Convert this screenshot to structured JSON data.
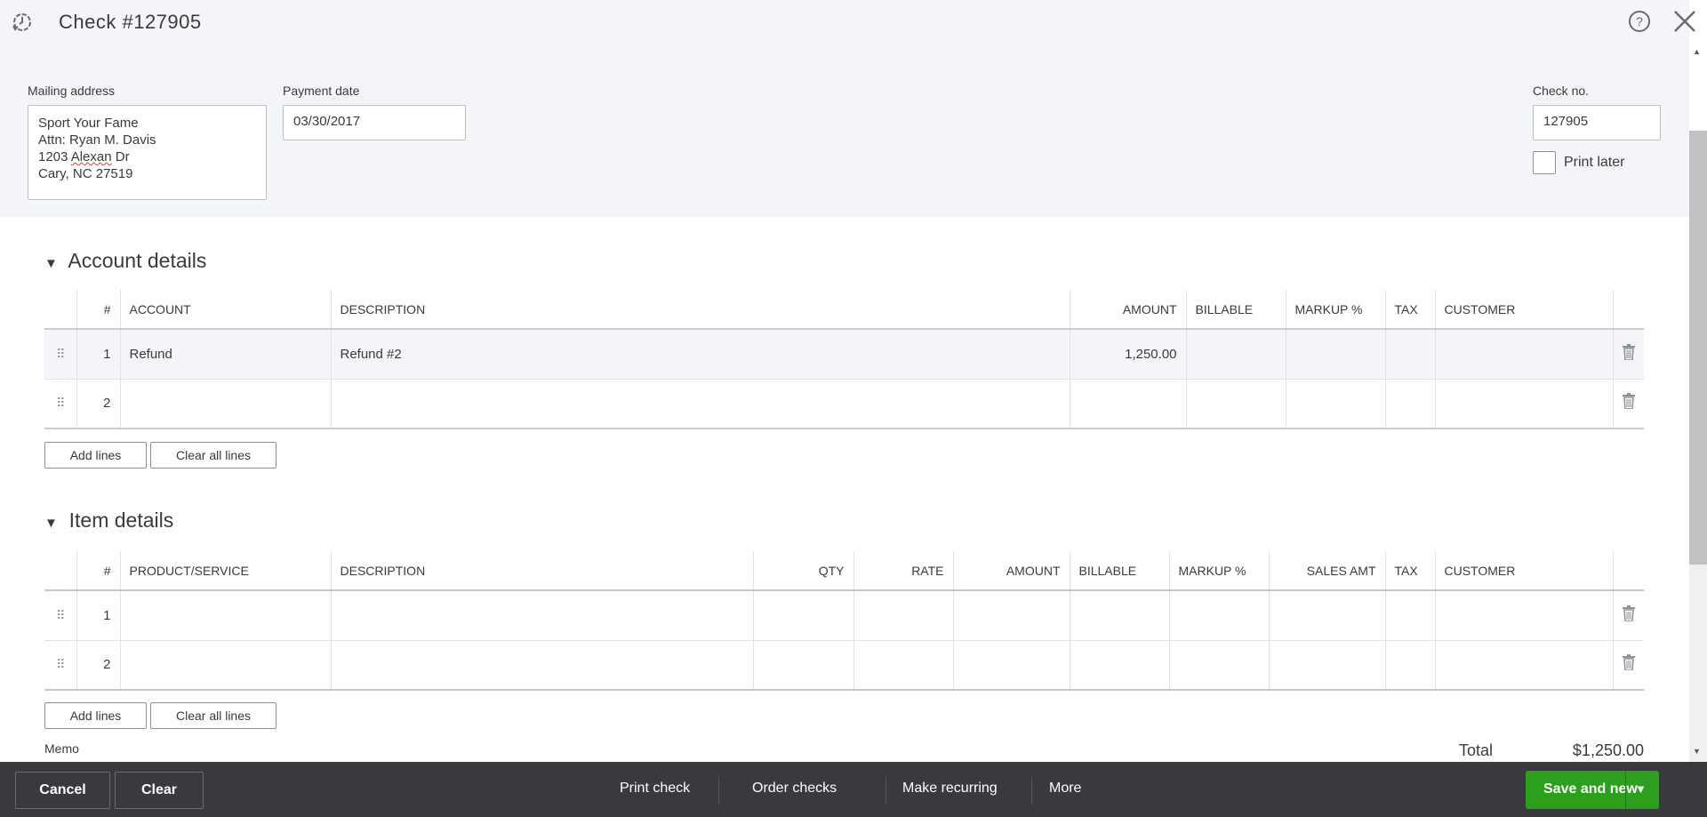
{
  "header": {
    "title": "Check #127905",
    "help_icon": "help-icon",
    "close_icon": "close-icon",
    "history_icon": "history-icon"
  },
  "form": {
    "mailing_label": "Mailing address",
    "address_lines": [
      "Sport Your Fame",
      "Attn: Ryan M. Davis",
      "1203",
      "Alexan",
      "Dr",
      "Cary, NC 27519"
    ],
    "payment_date_label": "Payment date",
    "payment_date": "03/30/2017",
    "check_no_label": "Check no.",
    "check_no": "127905",
    "print_later_label": "Print later",
    "print_later": false
  },
  "account": {
    "title": "Account details",
    "headers": [
      "#",
      "ACCOUNT",
      "DESCRIPTION",
      "AMOUNT",
      "BILLABLE",
      "MARKUP %",
      "TAX",
      "CUSTOMER"
    ],
    "rows": [
      {
        "n": "1",
        "account": "Refund",
        "description": "Refund #2",
        "amount": "1,250.00"
      },
      {
        "n": "2",
        "account": "",
        "description": "",
        "amount": ""
      }
    ],
    "add_lines": "Add lines",
    "clear_lines": "Clear all lines"
  },
  "items": {
    "title": "Item details",
    "headers": [
      "#",
      "PRODUCT/SERVICE",
      "DESCRIPTION",
      "QTY",
      "RATE",
      "AMOUNT",
      "BILLABLE",
      "MARKUP %",
      "SALES AMT",
      "TAX",
      "CUSTOMER"
    ],
    "rows": [
      {
        "n": "1"
      },
      {
        "n": "2"
      }
    ],
    "add_lines": "Add lines",
    "clear_lines": "Clear all lines"
  },
  "memo_label": "Memo",
  "total_label": "Total",
  "total_value": "$1,250.00",
  "footer": {
    "cancel": "Cancel",
    "clear": "Clear",
    "print_check": "Print check",
    "order_checks": "Order checks",
    "make_recurring": "Make recurring",
    "more": "More",
    "save_and_new": "Save and new"
  },
  "colors": {
    "accent": "#2ca01c",
    "footer_bg": "#393a3d"
  }
}
